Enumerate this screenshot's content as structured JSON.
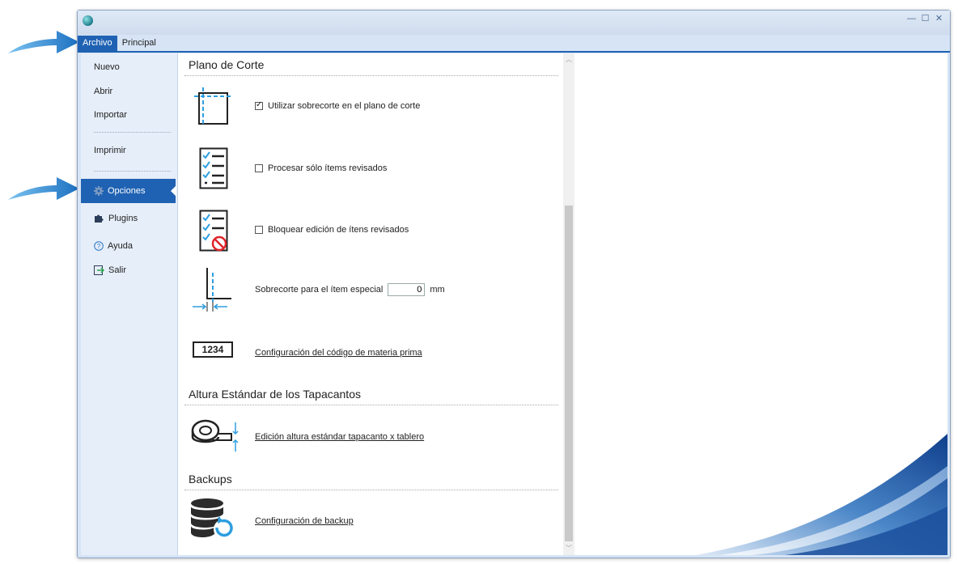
{
  "window": {
    "controls": {
      "minimize": "—",
      "maximize": "☐",
      "close": "✕"
    }
  },
  "tabs": [
    {
      "label": "Archivo",
      "active": true
    },
    {
      "label": "Principal",
      "active": false
    }
  ],
  "sidebar": {
    "items": [
      {
        "label": "Nuevo"
      },
      {
        "label": "Abrir"
      },
      {
        "label": "Importar"
      },
      {
        "label": "Imprimir"
      },
      {
        "label": "Opciones",
        "icon": "gear-icon",
        "selected": true
      },
      {
        "label": "Plugins",
        "icon": "puzzle-icon"
      },
      {
        "label": "Ayuda",
        "icon": "help-icon"
      },
      {
        "label": "Salir",
        "icon": "exit-icon"
      }
    ]
  },
  "sections": {
    "plano": {
      "title": "Plano de Corte",
      "sobrecorte_checkbox": {
        "label": "Utilizar sobrecorte en el plano de corte",
        "checked": true
      },
      "procesar_checkbox": {
        "label": "Procesar sólo ítems revisados",
        "checked": false
      },
      "bloquear_checkbox": {
        "label": "Bloquear edición de ítens revisados",
        "checked": false
      },
      "especial": {
        "label": "Sobrecorte para el ítem especial",
        "value": "0",
        "unit": "mm"
      },
      "codigo_icon_text": "1234",
      "codigo_link": "Configuración del código de materia prima"
    },
    "altura": {
      "title": "Altura Estándar de los Tapacantos",
      "link": "Edición altura estándar tapacanto x tablero"
    },
    "backups": {
      "title": "Backups",
      "link": "Configuración de backup"
    }
  },
  "colors": {
    "accent": "#1f62b3",
    "icon_blue": "#2d9ee0",
    "arrow_blue": "#1f78c8"
  }
}
